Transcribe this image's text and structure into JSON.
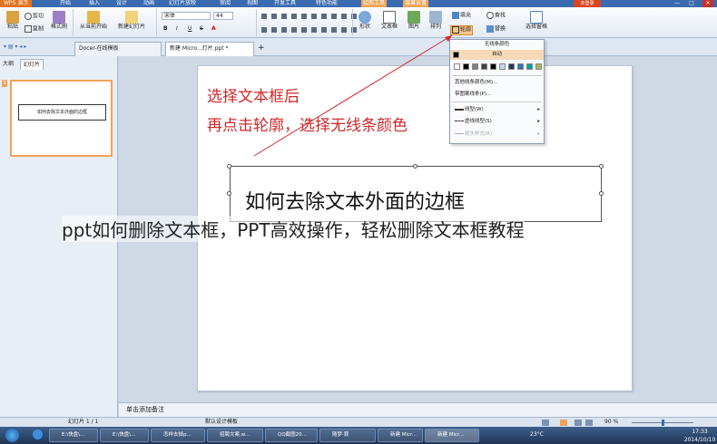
{
  "menubar": {
    "app": "WPS 演示",
    "items": [
      "开始",
      "插入",
      "设计",
      "动画",
      "幻灯片放映",
      "审阅",
      "视图",
      "开发工具",
      "特色功能",
      "绘图工具",
      "效果设置"
    ],
    "login": "未登录",
    "controls": [
      "—",
      "□",
      "✕"
    ]
  },
  "ribbon": {
    "paste": "粘贴",
    "cut": "剪切",
    "copy": "复制",
    "format_painter": "格式刷",
    "from_current": "从当前开始",
    "new_slide": "新建幻灯片",
    "font_name": "宋体",
    "font_size": "44",
    "shape": "形状",
    "textbox": "文本框",
    "picture": "图片",
    "arrange": "排列",
    "fill": "填充",
    "outline": "轮廓",
    "find": "查找",
    "replace": "替换",
    "select_pane": "选择窗格",
    "bold": "B",
    "italic": "I",
    "underline": "U",
    "strike": "S"
  },
  "doctabs": {
    "docer": "Docer-在线模板",
    "file": "新建 Micro...灯片.ppt *",
    "add": "+"
  },
  "left_panel": {
    "tab_outline": "大纲",
    "tab_slides": "幻灯片",
    "slide_number": "1",
    "thumb_text": "如何去除文本外面的边框"
  },
  "slide": {
    "annotation_line1": "选择文本框后",
    "annotation_line2": "再点击轮廓，选择无线条颜色",
    "textbox_text": "如何去除文本外面的边框"
  },
  "overlay_title": "ppt如何删除文本框，PPT高效操作，轻松删除文本框教程",
  "dropdown": {
    "no_line": "无线条颜色",
    "auto": "自动",
    "swatches": [
      "#ffffff",
      "#000000",
      "#7f7f7f",
      "#404040",
      "#000000",
      "#c6d9f1",
      "#1f3864",
      "#2e75b6",
      "#00a19a",
      "#9bbb59"
    ],
    "more_colors": "其他线条颜色(M)...",
    "pattern": "带图案线条(P)...",
    "line_style": "线型(W)",
    "dash_style": "虚线线型(S)",
    "arrow_style": "箭头样式(R)"
  },
  "notes": "单击添加备注",
  "status": {
    "slide_count": "幻灯片 1 / 1",
    "template": "默认设计模板",
    "zoom": "90 %"
  },
  "taskbar": {
    "items": [
      "E:\\快盘\\...",
      "E:\\快盘\\...",
      "怎样去掉p...",
      "招聘文案.w...",
      "QQ截图20...",
      "随梦·罪",
      "新建 Micr..."
    ],
    "time": "17:33",
    "date": "2014/10/10",
    "weather": "23°C"
  },
  "colors": {
    "accent": "#3a6bb0",
    "annotation": "#d0272a",
    "highlight": "#f0a45a"
  }
}
